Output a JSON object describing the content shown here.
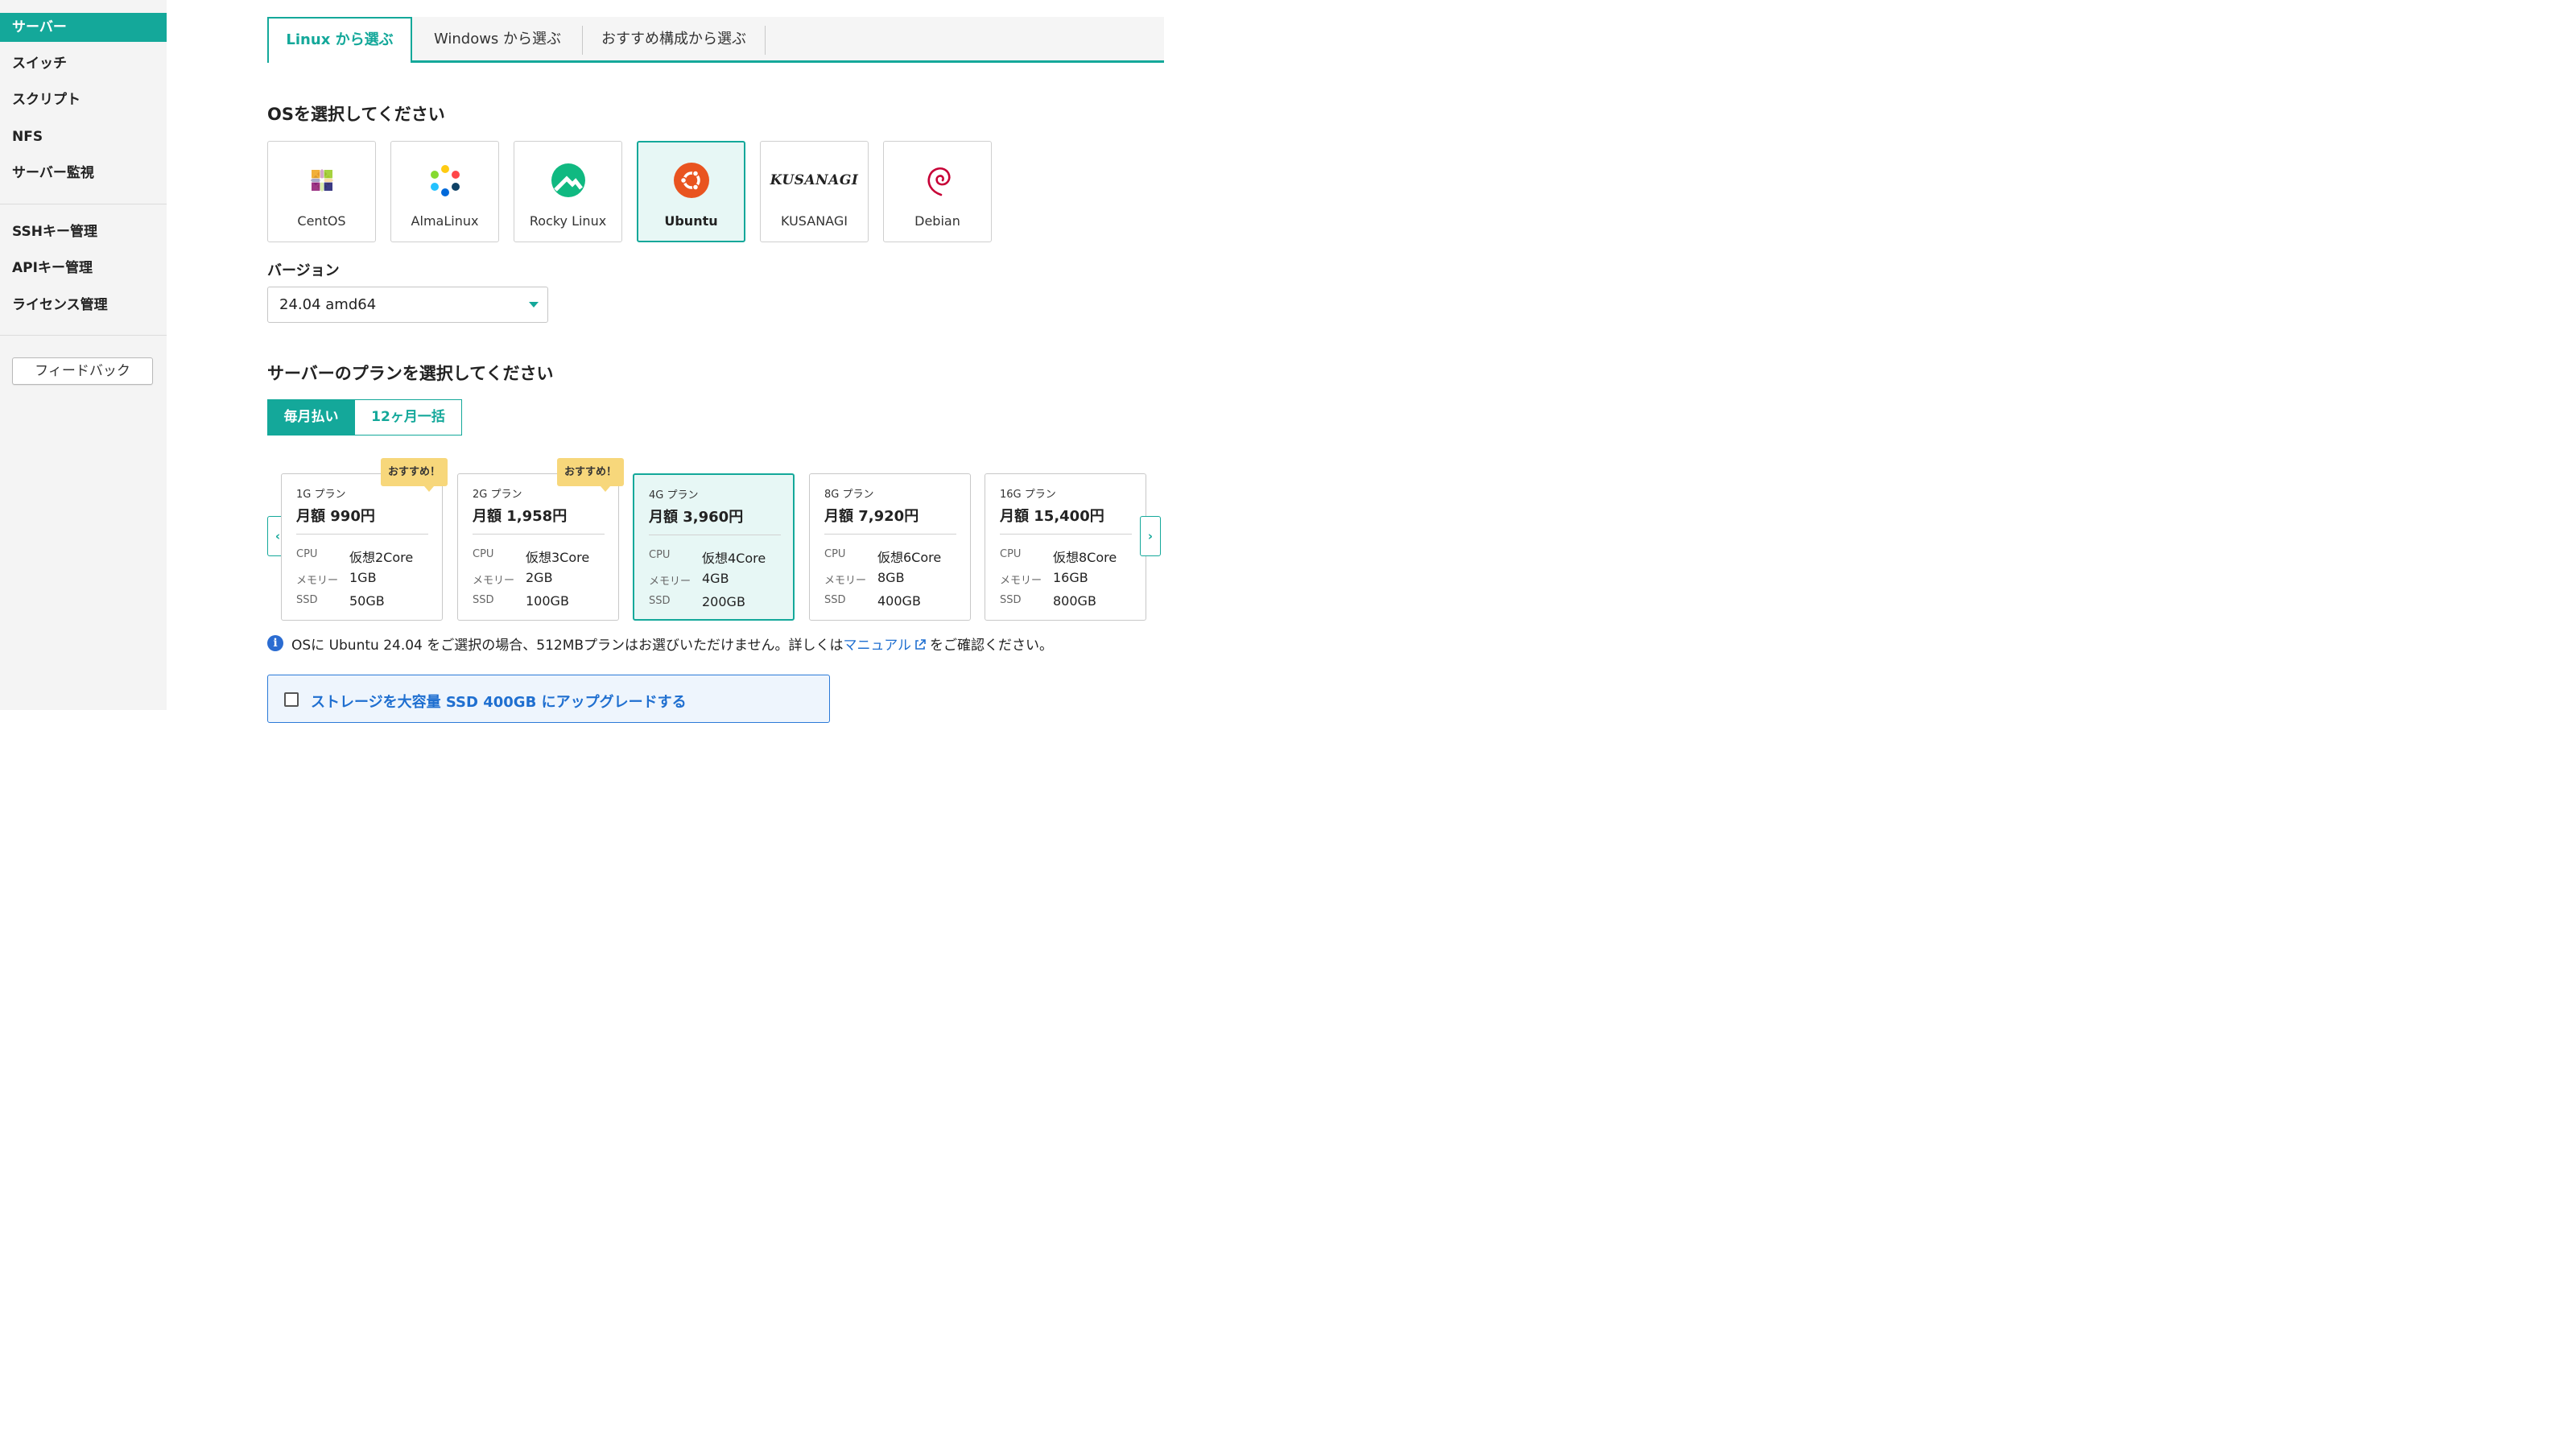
{
  "sidebar": {
    "items": [
      {
        "label": "サーバー",
        "active": true
      },
      {
        "label": "スイッチ"
      },
      {
        "label": "スクリプト"
      },
      {
        "label": "NFS"
      },
      {
        "label": "サーバー監視"
      },
      {
        "label": "SSHキー管理"
      },
      {
        "label": "APIキー管理"
      },
      {
        "label": "ライセンス管理"
      }
    ],
    "feedback_label": "フィードバック"
  },
  "tabs": [
    {
      "label": "Linux から選ぶ",
      "active": true
    },
    {
      "label": "Windows から選ぶ"
    },
    {
      "label": "おすすめ構成から選ぶ"
    }
  ],
  "os_section": {
    "heading": "OSを選択してください",
    "options": [
      {
        "name": "CentOS",
        "icon": "centos-logo"
      },
      {
        "name": "AlmaLinux",
        "icon": "almalinux-logo"
      },
      {
        "name": "Rocky Linux",
        "icon": "rocky-linux-logo"
      },
      {
        "name": "Ubuntu",
        "icon": "ubuntu-logo",
        "selected": true
      },
      {
        "name": "KUSANAGI",
        "icon": "kusanagi-logo",
        "logo_text": "KUSANAGI"
      },
      {
        "name": "Debian",
        "icon": "debian-logo"
      }
    ]
  },
  "version": {
    "label": "バージョン",
    "selected": "24.04 amd64"
  },
  "plan_section": {
    "heading": "サーバーのプランを選択してください",
    "billing": {
      "monthly": "毎月払い",
      "yearly": "12ヶ月一括",
      "active": "monthly"
    },
    "recommend_badge": "おすすめ！",
    "spec_labels": {
      "cpu": "CPU",
      "memory": "メモリー",
      "ssd": "SSD"
    },
    "plans": [
      {
        "name": "1G プラン",
        "price": "月額 990円",
        "cpu": "仮想2Core",
        "memory": "1GB",
        "ssd": "50GB",
        "recommended": true
      },
      {
        "name": "2G プラン",
        "price": "月額 1,958円",
        "cpu": "仮想3Core",
        "memory": "2GB",
        "ssd": "100GB",
        "recommended": true
      },
      {
        "name": "4G プラン",
        "price": "月額 3,960円",
        "cpu": "仮想4Core",
        "memory": "4GB",
        "ssd": "200GB",
        "selected": true
      },
      {
        "name": "8G プラン",
        "price": "月額 7,920円",
        "cpu": "仮想6Core",
        "memory": "8GB",
        "ssd": "400GB"
      },
      {
        "name": "16G プラン",
        "price": "月額 15,400円",
        "cpu": "仮想8Core",
        "memory": "16GB",
        "ssd": "800GB"
      }
    ]
  },
  "notice": {
    "before": "OSに Ubuntu 24.04 をご選択の場合、512MBプランはお選びいただけません。詳しくは",
    "link": "マニュアル",
    "after": "をご確認ください。"
  },
  "upgrade": {
    "label": "ストレージを大容量 SSD 400GB にアップグレードする",
    "checked": false
  },
  "colors": {
    "accent": "#14a89a",
    "link": "#1f6fd0",
    "badge": "#f7d77b"
  }
}
